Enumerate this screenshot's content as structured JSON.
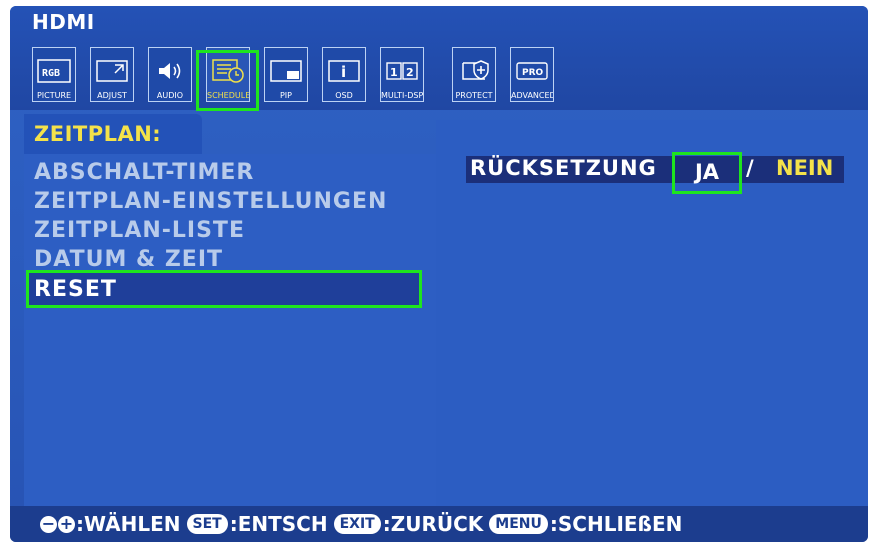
{
  "source": "HDMI",
  "colors": {
    "background": "#2f62c4",
    "highlight": "#1ee51e",
    "accent": "#f4e24a"
  },
  "icons": [
    {
      "name": "picture-icon",
      "glyph": "RGB",
      "label": "PICTURE"
    },
    {
      "name": "adjust-icon",
      "glyph": "",
      "label": "ADJUST"
    },
    {
      "name": "audio-icon",
      "glyph": "",
      "label": "AUDIO"
    },
    {
      "name": "schedule-icon",
      "glyph": "",
      "label": "SCHEDULE",
      "active": true
    },
    {
      "name": "pip-icon",
      "glyph": "",
      "label": "PIP"
    },
    {
      "name": "osd-icon",
      "glyph": "i",
      "label": "OSD"
    },
    {
      "name": "multi-dsp-icon",
      "glyph": "12",
      "label": "MULTI-DSP"
    },
    {
      "name": "protect-icon",
      "glyph": "",
      "label": "PROTECT"
    },
    {
      "name": "advanced-icon",
      "glyph": "PRO",
      "label": "ADVANCED"
    }
  ],
  "section_title": "ZEITPLAN:",
  "menu": [
    "ABSCHALT-TIMER",
    "ZEITPLAN-EINSTELLUNGEN",
    "ZEITPLAN-LISTE",
    "DATUM & ZEIT",
    "RESET"
  ],
  "selected_menu_index": 4,
  "setting": {
    "label": "RÜCKSETZUNG",
    "option_yes": "JA",
    "separator": "/",
    "option_no": "NEIN"
  },
  "footer": {
    "select_text": ":WÄHLEN",
    "set_key": "SET",
    "set_text": ":ENTSCH",
    "exit_key": "EXIT",
    "exit_text": ":ZURÜCK",
    "menu_key": "MENU",
    "menu_text": ":SCHLIEßEN"
  }
}
